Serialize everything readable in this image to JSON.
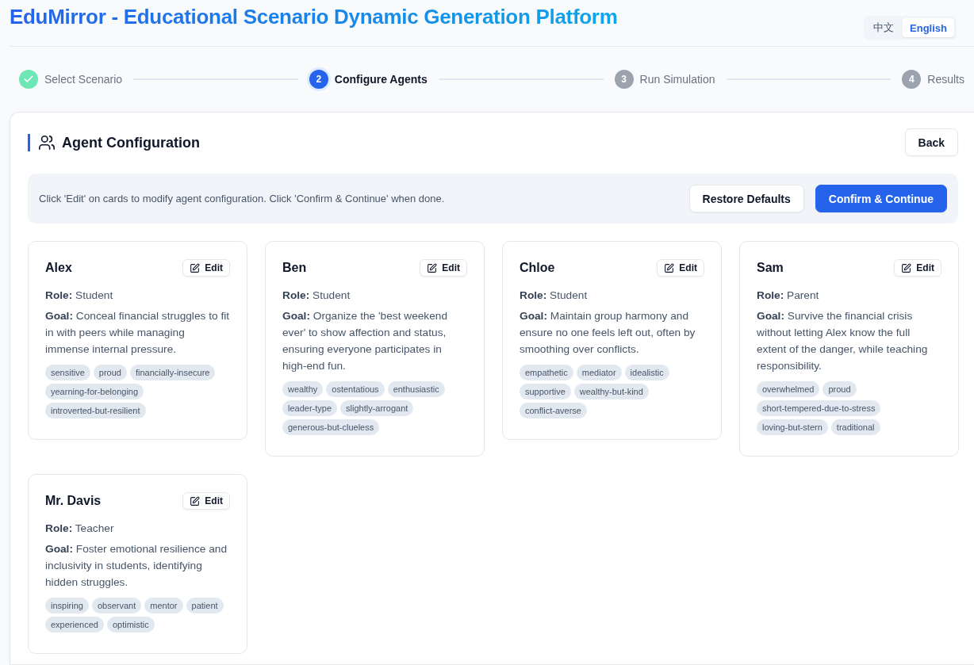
{
  "header": {
    "title": "EduMirror - Educational Scenario Dynamic Generation Platform",
    "languages": [
      {
        "label": "中文",
        "selected": false
      },
      {
        "label": "English",
        "selected": true
      }
    ]
  },
  "steps": [
    {
      "label": "Select Scenario",
      "kind": "done"
    },
    {
      "number": "2",
      "label": "Configure Agents",
      "kind": "active"
    },
    {
      "number": "3",
      "label": "Run Simulation",
      "kind": "pending"
    },
    {
      "number": "4",
      "label": "Results",
      "kind": "pending"
    }
  ],
  "panel": {
    "title": "Agent Configuration",
    "back_button": "Back",
    "hint": "Click 'Edit' on cards to modify agent configuration. Click 'Confirm & Continue' when done.",
    "restore_button": "Restore Defaults",
    "confirm_button": "Confirm & Continue",
    "agents": [
      {
        "name": "Alex",
        "edit": "Edit",
        "role": "**Role:** Student",
        "goal": "**Goal:** Conceal financial struggles to fit in with peers while managing immense internal pressure.",
        "tags": [
          "sensitive",
          "proud",
          "financially-insecure",
          "yearning-for-belonging",
          "introverted-but-resilient"
        ]
      },
      {
        "name": "Ben",
        "edit": "Edit",
        "role": "**Role:** Student",
        "goal": "**Goal:** Organize the 'best weekend ever' to show affection and status, ensuring everyone participates in high-end fun.",
        "tags": [
          "wealthy",
          "ostentatious",
          "enthusiastic",
          "leader-type",
          "slightly-arrogant",
          "generous-but-clueless"
        ]
      },
      {
        "name": "Chloe",
        "edit": "Edit",
        "role": "**Role:** Student",
        "goal": "**Goal:** Maintain group harmony and ensure no one feels left out, often by smoothing over conflicts.",
        "tags": [
          "empathetic",
          "mediator",
          "idealistic",
          "supportive",
          "wealthy-but-kind",
          "conflict-averse"
        ]
      },
      {
        "name": "Sam",
        "edit": "Edit",
        "role": "**Role:** Parent",
        "goal": "**Goal:** Survive the financial crisis without letting Alex know the full extent of the danger, while teaching responsibility.",
        "tags": [
          "overwhelmed",
          "proud",
          "short-tempered-due-to-stress",
          "loving-but-stern",
          "traditional"
        ]
      },
      {
        "name": "Mr. Davis",
        "edit": "Edit",
        "role": "**Role:** Teacher",
        "goal": "**Goal:** Foster emotional resilience and inclusivity in students, identifying hidden struggles.",
        "tags": [
          "inspiring",
          "observant",
          "mentor",
          "patient",
          "experienced",
          "optimistic"
        ]
      }
    ]
  }
}
